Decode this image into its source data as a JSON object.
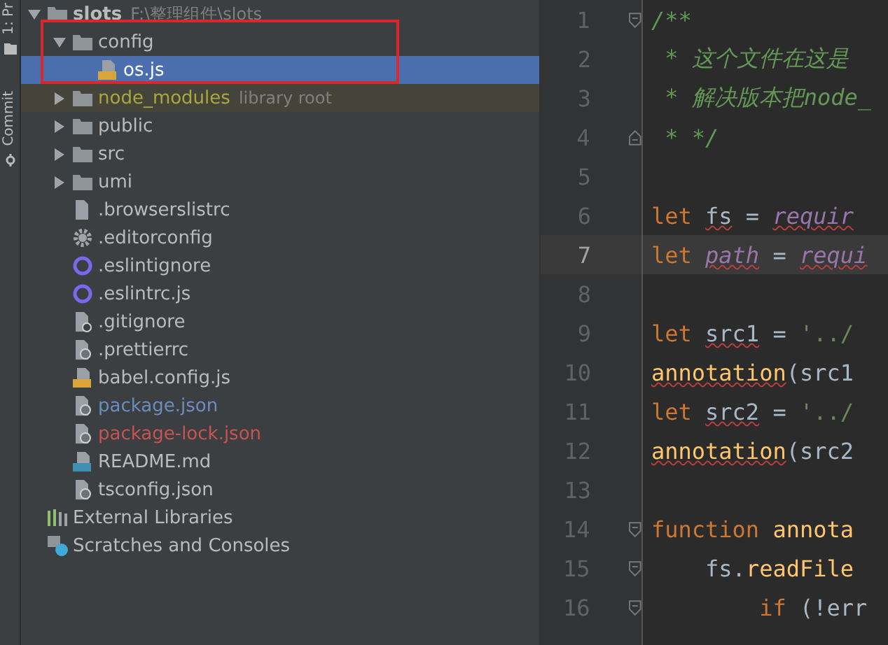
{
  "tool_strip": [
    {
      "label": "1: Pr",
      "kind": "project"
    },
    {
      "label": "Commit",
      "kind": "commit"
    }
  ],
  "tree": [
    {
      "name": "slots",
      "hint": "F:\\整理组件\\slots",
      "kind": "folder",
      "bold": true,
      "expanded": true,
      "selected": false,
      "children": [
        {
          "name": "config",
          "kind": "folder",
          "expanded": true,
          "selected": false,
          "children": [
            {
              "name": "os.js",
              "kind": "js",
              "selected": true
            }
          ]
        },
        {
          "name": "node_modules",
          "hint": "library root",
          "kind": "folder",
          "expanded": false,
          "selected": false,
          "excluded": true,
          "color": "#a8a83c"
        },
        {
          "name": "public",
          "kind": "folder",
          "expanded": false,
          "selected": false
        },
        {
          "name": "src",
          "kind": "folder",
          "expanded": false,
          "selected": false
        },
        {
          "name": "umi",
          "kind": "folder",
          "expanded": false,
          "selected": false
        },
        {
          "name": ".browserslistrc",
          "kind": "text",
          "selected": false
        },
        {
          "name": ".editorconfig",
          "kind": "gear",
          "selected": false
        },
        {
          "name": ".eslintignore",
          "kind": "ring",
          "selected": false
        },
        {
          "name": ".eslintrc.js",
          "kind": "ring",
          "selected": false
        },
        {
          "name": ".gitignore",
          "kind": "ignore",
          "selected": false
        },
        {
          "name": ".prettierrc",
          "kind": "config",
          "selected": false
        },
        {
          "name": "babel.config.js",
          "kind": "js",
          "selected": false
        },
        {
          "name": "package.json",
          "kind": "config",
          "selected": false,
          "color": "#6a8fbf"
        },
        {
          "name": "package-lock.json",
          "kind": "config",
          "selected": false,
          "color": "#c75450"
        },
        {
          "name": "README.md",
          "kind": "md",
          "selected": false
        },
        {
          "name": "tsconfig.json",
          "kind": "config",
          "selected": false
        }
      ]
    },
    {
      "name": "External Libraries",
      "kind": "library",
      "selected": false
    },
    {
      "name": "Scratches and Consoles",
      "kind": "scratch",
      "selected": false
    }
  ],
  "editor": {
    "lines": [
      {
        "number": "1",
        "current": false,
        "fold_open": true,
        "fold_close": false,
        "tokens": [
          {
            "text": "/**",
            "kind": "comment",
            "warn": false
          }
        ]
      },
      {
        "number": "2",
        "current": false,
        "fold_open": false,
        "fold_close": false,
        "tokens": [
          {
            "text": " * 这个文件在这是",
            "kind": "comment",
            "warn": false
          }
        ]
      },
      {
        "number": "3",
        "current": false,
        "fold_open": false,
        "fold_close": false,
        "tokens": [
          {
            "text": " * 解决版本把node_",
            "kind": "comment",
            "warn": false
          }
        ]
      },
      {
        "number": "4",
        "current": false,
        "fold_open": false,
        "fold_close": true,
        "tokens": [
          {
            "text": " * */",
            "kind": "comment",
            "warn": false
          }
        ]
      },
      {
        "number": "5",
        "current": false,
        "fold_open": false,
        "fold_close": false
      },
      {
        "number": "6",
        "current": false,
        "fold_open": false,
        "fold_close": false,
        "tokens": [
          {
            "text": "let ",
            "kind": "keyword",
            "warn": false
          },
          {
            "text": "fs",
            "kind": "plain",
            "warn": true
          },
          {
            "text": " = ",
            "kind": "plain",
            "warn": false
          },
          {
            "text": "requir",
            "kind": "global",
            "warn": true
          }
        ]
      },
      {
        "number": "7",
        "current": true,
        "fold_open": false,
        "fold_close": false,
        "tokens": [
          {
            "text": "let ",
            "kind": "keyword",
            "warn": false
          },
          {
            "text": "path",
            "kind": "global",
            "warn": true
          },
          {
            "text": " = ",
            "kind": "plain",
            "warn": false
          },
          {
            "text": "requi",
            "kind": "global",
            "warn": true
          }
        ]
      },
      {
        "number": "8",
        "current": false,
        "fold_open": false,
        "fold_close": false
      },
      {
        "number": "9",
        "current": false,
        "fold_open": false,
        "fold_close": false,
        "tokens": [
          {
            "text": "let ",
            "kind": "keyword",
            "warn": false
          },
          {
            "text": "src1",
            "kind": "plain",
            "warn": true
          },
          {
            "text": " = ",
            "kind": "plain",
            "warn": false
          },
          {
            "text": "'../",
            "kind": "string",
            "warn": false
          }
        ]
      },
      {
        "number": "10",
        "current": false,
        "fold_open": false,
        "fold_close": false,
        "tokens": [
          {
            "text": "annotation",
            "kind": "function",
            "warn": true
          },
          {
            "text": "(src1",
            "kind": "plain",
            "warn": false
          }
        ]
      },
      {
        "number": "11",
        "current": false,
        "fold_open": false,
        "fold_close": false,
        "tokens": [
          {
            "text": "let ",
            "kind": "keyword",
            "warn": false
          },
          {
            "text": "src2",
            "kind": "plain",
            "warn": true
          },
          {
            "text": " = ",
            "kind": "plain",
            "warn": false
          },
          {
            "text": "'../",
            "kind": "string",
            "warn": false
          }
        ]
      },
      {
        "number": "12",
        "current": false,
        "fold_open": false,
        "fold_close": false,
        "tokens": [
          {
            "text": "annotation",
            "kind": "function",
            "warn": true
          },
          {
            "text": "(src2",
            "kind": "plain",
            "warn": false
          }
        ]
      },
      {
        "number": "13",
        "current": false,
        "fold_open": false,
        "fold_close": false
      },
      {
        "number": "14",
        "current": false,
        "fold_open": true,
        "fold_close": false,
        "tokens": [
          {
            "text": "function ",
            "kind": "keyword",
            "warn": false
          },
          {
            "text": "annota",
            "kind": "function",
            "warn": false
          }
        ]
      },
      {
        "number": "15",
        "current": false,
        "fold_open": true,
        "fold_close": false,
        "tokens": [
          {
            "text": "    fs.",
            "kind": "plain",
            "warn": false
          },
          {
            "text": "readFile",
            "kind": "function",
            "warn": false
          }
        ]
      },
      {
        "number": "16",
        "current": false,
        "fold_open": true,
        "fold_close": false,
        "tokens": [
          {
            "text": "        if ",
            "kind": "keyword",
            "warn": false
          },
          {
            "text": "(!err",
            "kind": "plain",
            "warn": false
          }
        ]
      }
    ]
  }
}
